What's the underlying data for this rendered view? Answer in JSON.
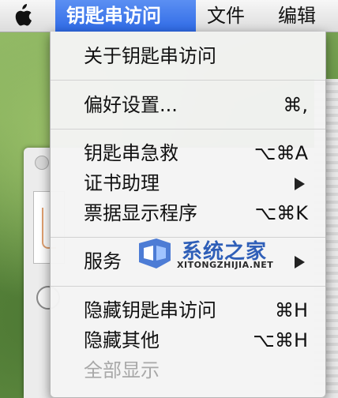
{
  "menubar": {
    "apple_icon": "apple-logo-icon",
    "menus": [
      {
        "label": "钥匙串访问",
        "active": true
      },
      {
        "label": "文件",
        "active": false
      },
      {
        "label": "编辑",
        "active": false
      }
    ]
  },
  "dropdown": {
    "items": [
      {
        "label": "关于钥匙串访问",
        "shortcut": "",
        "submenu": false,
        "enabled": true
      },
      {
        "label": "偏好设置...",
        "shortcut": "⌘,",
        "submenu": false,
        "enabled": true
      },
      {
        "label": "钥匙串急救",
        "shortcut": "⌥⌘A",
        "submenu": false,
        "enabled": true
      },
      {
        "label": "证书助理",
        "shortcut": "",
        "submenu": true,
        "enabled": true
      },
      {
        "label": "票据显示程序",
        "shortcut": "⌥⌘K",
        "submenu": false,
        "enabled": true
      },
      {
        "label": "服务",
        "shortcut": "",
        "submenu": true,
        "enabled": true
      },
      {
        "label": "隐藏钥匙串访问",
        "shortcut": "⌘H",
        "submenu": false,
        "enabled": true
      },
      {
        "label": "隐藏其他",
        "shortcut": "⌥⌘H",
        "submenu": false,
        "enabled": true
      },
      {
        "label": "全部显示",
        "shortcut": "",
        "submenu": false,
        "enabled": false
      }
    ]
  },
  "watermark": {
    "name_cn": "系统之家",
    "name_en": "XITONGZHIJIA.NET"
  },
  "colors": {
    "menu_highlight": "#3a74ea",
    "disabled_text": "#a8a8a8",
    "watermark_blue": "#2f5fb8"
  }
}
